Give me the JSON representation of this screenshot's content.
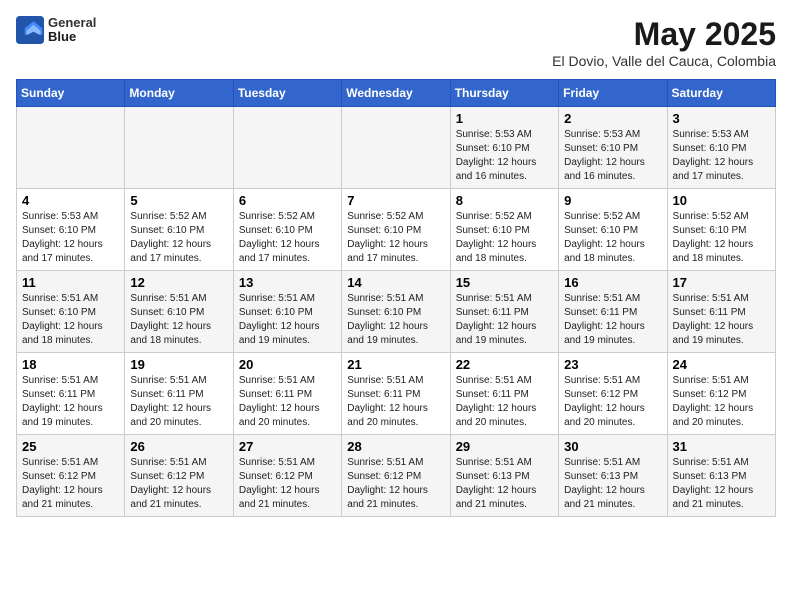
{
  "header": {
    "logo_line1": "General",
    "logo_line2": "Blue",
    "title": "May 2025",
    "subtitle": "El Dovio, Valle del Cauca, Colombia"
  },
  "weekdays": [
    "Sunday",
    "Monday",
    "Tuesday",
    "Wednesday",
    "Thursday",
    "Friday",
    "Saturday"
  ],
  "weeks": [
    [
      {
        "day": "",
        "info": ""
      },
      {
        "day": "",
        "info": ""
      },
      {
        "day": "",
        "info": ""
      },
      {
        "day": "",
        "info": ""
      },
      {
        "day": "1",
        "info": "Sunrise: 5:53 AM\nSunset: 6:10 PM\nDaylight: 12 hours\nand 16 minutes."
      },
      {
        "day": "2",
        "info": "Sunrise: 5:53 AM\nSunset: 6:10 PM\nDaylight: 12 hours\nand 16 minutes."
      },
      {
        "day": "3",
        "info": "Sunrise: 5:53 AM\nSunset: 6:10 PM\nDaylight: 12 hours\nand 17 minutes."
      }
    ],
    [
      {
        "day": "4",
        "info": "Sunrise: 5:53 AM\nSunset: 6:10 PM\nDaylight: 12 hours\nand 17 minutes."
      },
      {
        "day": "5",
        "info": "Sunrise: 5:52 AM\nSunset: 6:10 PM\nDaylight: 12 hours\nand 17 minutes."
      },
      {
        "day": "6",
        "info": "Sunrise: 5:52 AM\nSunset: 6:10 PM\nDaylight: 12 hours\nand 17 minutes."
      },
      {
        "day": "7",
        "info": "Sunrise: 5:52 AM\nSunset: 6:10 PM\nDaylight: 12 hours\nand 17 minutes."
      },
      {
        "day": "8",
        "info": "Sunrise: 5:52 AM\nSunset: 6:10 PM\nDaylight: 12 hours\nand 18 minutes."
      },
      {
        "day": "9",
        "info": "Sunrise: 5:52 AM\nSunset: 6:10 PM\nDaylight: 12 hours\nand 18 minutes."
      },
      {
        "day": "10",
        "info": "Sunrise: 5:52 AM\nSunset: 6:10 PM\nDaylight: 12 hours\nand 18 minutes."
      }
    ],
    [
      {
        "day": "11",
        "info": "Sunrise: 5:51 AM\nSunset: 6:10 PM\nDaylight: 12 hours\nand 18 minutes."
      },
      {
        "day": "12",
        "info": "Sunrise: 5:51 AM\nSunset: 6:10 PM\nDaylight: 12 hours\nand 18 minutes."
      },
      {
        "day": "13",
        "info": "Sunrise: 5:51 AM\nSunset: 6:10 PM\nDaylight: 12 hours\nand 19 minutes."
      },
      {
        "day": "14",
        "info": "Sunrise: 5:51 AM\nSunset: 6:10 PM\nDaylight: 12 hours\nand 19 minutes."
      },
      {
        "day": "15",
        "info": "Sunrise: 5:51 AM\nSunset: 6:11 PM\nDaylight: 12 hours\nand 19 minutes."
      },
      {
        "day": "16",
        "info": "Sunrise: 5:51 AM\nSunset: 6:11 PM\nDaylight: 12 hours\nand 19 minutes."
      },
      {
        "day": "17",
        "info": "Sunrise: 5:51 AM\nSunset: 6:11 PM\nDaylight: 12 hours\nand 19 minutes."
      }
    ],
    [
      {
        "day": "18",
        "info": "Sunrise: 5:51 AM\nSunset: 6:11 PM\nDaylight: 12 hours\nand 19 minutes."
      },
      {
        "day": "19",
        "info": "Sunrise: 5:51 AM\nSunset: 6:11 PM\nDaylight: 12 hours\nand 20 minutes."
      },
      {
        "day": "20",
        "info": "Sunrise: 5:51 AM\nSunset: 6:11 PM\nDaylight: 12 hours\nand 20 minutes."
      },
      {
        "day": "21",
        "info": "Sunrise: 5:51 AM\nSunset: 6:11 PM\nDaylight: 12 hours\nand 20 minutes."
      },
      {
        "day": "22",
        "info": "Sunrise: 5:51 AM\nSunset: 6:11 PM\nDaylight: 12 hours\nand 20 minutes."
      },
      {
        "day": "23",
        "info": "Sunrise: 5:51 AM\nSunset: 6:12 PM\nDaylight: 12 hours\nand 20 minutes."
      },
      {
        "day": "24",
        "info": "Sunrise: 5:51 AM\nSunset: 6:12 PM\nDaylight: 12 hours\nand 20 minutes."
      }
    ],
    [
      {
        "day": "25",
        "info": "Sunrise: 5:51 AM\nSunset: 6:12 PM\nDaylight: 12 hours\nand 21 minutes."
      },
      {
        "day": "26",
        "info": "Sunrise: 5:51 AM\nSunset: 6:12 PM\nDaylight: 12 hours\nand 21 minutes."
      },
      {
        "day": "27",
        "info": "Sunrise: 5:51 AM\nSunset: 6:12 PM\nDaylight: 12 hours\nand 21 minutes."
      },
      {
        "day": "28",
        "info": "Sunrise: 5:51 AM\nSunset: 6:12 PM\nDaylight: 12 hours\nand 21 minutes."
      },
      {
        "day": "29",
        "info": "Sunrise: 5:51 AM\nSunset: 6:13 PM\nDaylight: 12 hours\nand 21 minutes."
      },
      {
        "day": "30",
        "info": "Sunrise: 5:51 AM\nSunset: 6:13 PM\nDaylight: 12 hours\nand 21 minutes."
      },
      {
        "day": "31",
        "info": "Sunrise: 5:51 AM\nSunset: 6:13 PM\nDaylight: 12 hours\nand 21 minutes."
      }
    ]
  ]
}
